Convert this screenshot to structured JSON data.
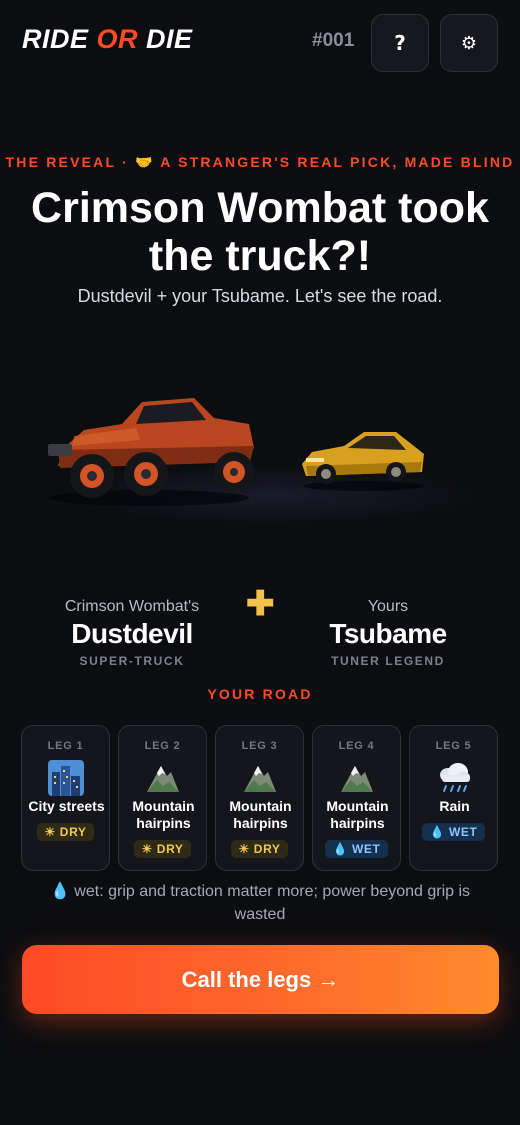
{
  "header": {
    "logo_part1": "RIDE ",
    "logo_accent": "OR",
    "logo_part2": " DIE",
    "issue": "#001",
    "help_label": "?",
    "settings_label": "⚙"
  },
  "reveal": {
    "kicker": "THE REVEAL · 🤝 A STRANGER'S REAL PICK, MADE BLIND",
    "headline": "Crimson Wombat took the truck?!",
    "subline": "Dustdevil + your Tsubame. Let's see the road."
  },
  "picks": {
    "left": {
      "owner": "Crimson Wombat's",
      "name": "Dustdevil",
      "class": "SUPER-TRUCK"
    },
    "plus": "✚",
    "right": {
      "owner": "Yours",
      "name": "Tsubame",
      "class": "TUNER LEGEND"
    }
  },
  "road": {
    "label": "YOUR ROAD",
    "legs": [
      {
        "num": "LEG 1",
        "icon": "city-icon",
        "name": "City streets",
        "condition": "☀ DRY",
        "type": "dry"
      },
      {
        "num": "LEG 2",
        "icon": "mountain-icon",
        "name": "Mountain hairpins",
        "condition": "☀ DRY",
        "type": "dry"
      },
      {
        "num": "LEG 3",
        "icon": "mountain-icon",
        "name": "Mountain hairpins",
        "condition": "☀ DRY",
        "type": "dry"
      },
      {
        "num": "LEG 4",
        "icon": "mountain-icon",
        "name": "Mountain hairpins",
        "condition": "💧 WET",
        "type": "wet"
      },
      {
        "num": "LEG 5",
        "icon": "rain-cloud-icon",
        "name": "Rain",
        "condition": "💧 WET",
        "type": "wet"
      }
    ],
    "note": "💧 wet: grip and traction matter more; power beyond grip is wasted"
  },
  "cta": {
    "label": "Call the legs →"
  },
  "colors": {
    "accent": "#ff4a26",
    "gold": "#f2c14a",
    "background": "#0c0d10"
  }
}
